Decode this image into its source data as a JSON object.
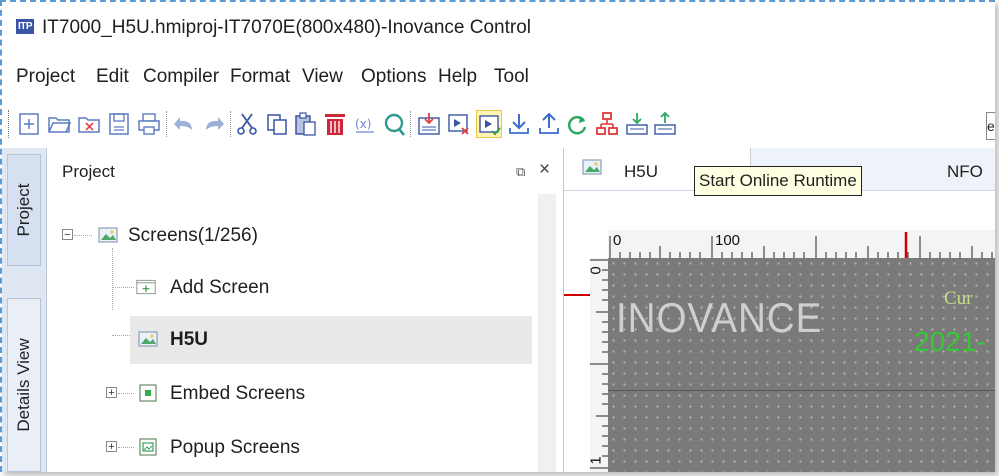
{
  "window": {
    "app_icon": "ITP",
    "title": "IT7000_H5U.hmiproj-IT7070E(800x480)-Inovance Control"
  },
  "menu": [
    "Project",
    "Edit",
    "Compiler",
    "Format",
    "View",
    "Options",
    "Help",
    "Tool"
  ],
  "toolbar": {
    "buttons": [
      "new-file-icon",
      "open-folder-icon",
      "close-project-icon",
      "save-icon",
      "print-icon",
      "undo-icon",
      "redo-icon",
      "cut-icon",
      "copy-icon",
      "paste-icon",
      "delete-icon",
      "variable-icon",
      "search-icon",
      "download-icon",
      "offline-simulation-icon",
      "start-online-runtime-icon",
      "download-arrow-icon",
      "upload-arrow-icon",
      "refresh-icon",
      "network-icon",
      "download-plc-icon",
      "upload-plc-icon"
    ],
    "edge_text": "e"
  },
  "side_tabs": {
    "project": "Project",
    "details": "Details View"
  },
  "project_panel": {
    "title": "Project",
    "tree": [
      {
        "label": "Screens(1/256)",
        "icon": "screen-icon",
        "expander": "−"
      },
      {
        "label": "Add Screen",
        "icon": "add-screen-icon"
      },
      {
        "label": "H5U",
        "icon": "screen-icon",
        "selected": true
      },
      {
        "label": "Embed Screens",
        "icon": "embed-screen-icon",
        "expander": "+"
      },
      {
        "label": "Popup Screens",
        "icon": "popup-screen-icon",
        "expander": "+"
      }
    ]
  },
  "editor": {
    "active_tab": "H5U",
    "second_tab_partial": "NFO",
    "tooltip": "Start Online Runtime",
    "ruler_top": [
      "0",
      "100"
    ],
    "ruler_left": [
      "0",
      "1"
    ],
    "canvas": {
      "logo": "INOVANCE",
      "cur_partial": "Cur",
      "date_partial": "2021-"
    }
  },
  "colors": {
    "accent_blue": "#3a55a4",
    "tooltip_bg": "#ffffe1",
    "canvas_bg": "#7a7a7a",
    "date_green": "#35c835",
    "ruler_marker_red": "#d00000"
  }
}
